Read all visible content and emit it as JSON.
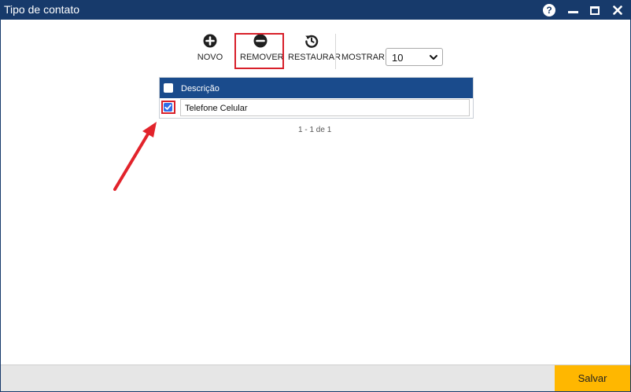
{
  "window": {
    "title": "Tipo de contato",
    "help_label": "?"
  },
  "toolbar": {
    "new_label": "NOVO",
    "remove_label": "REMOVER",
    "restore_label": "RESTAURAR",
    "show_label": "MOSTRAR:",
    "show_value": "10"
  },
  "grid": {
    "header": "Descrição",
    "rows": [
      {
        "value": "Telefone Celular",
        "checked": true
      }
    ],
    "pager": "1 - 1 de 1"
  },
  "footer": {
    "save_label": "Salvar"
  },
  "colors": {
    "titlebar": "#173a6b",
    "grid_header": "#1a4b8c",
    "highlight": "#d8202a",
    "save_button": "#ffb700"
  }
}
